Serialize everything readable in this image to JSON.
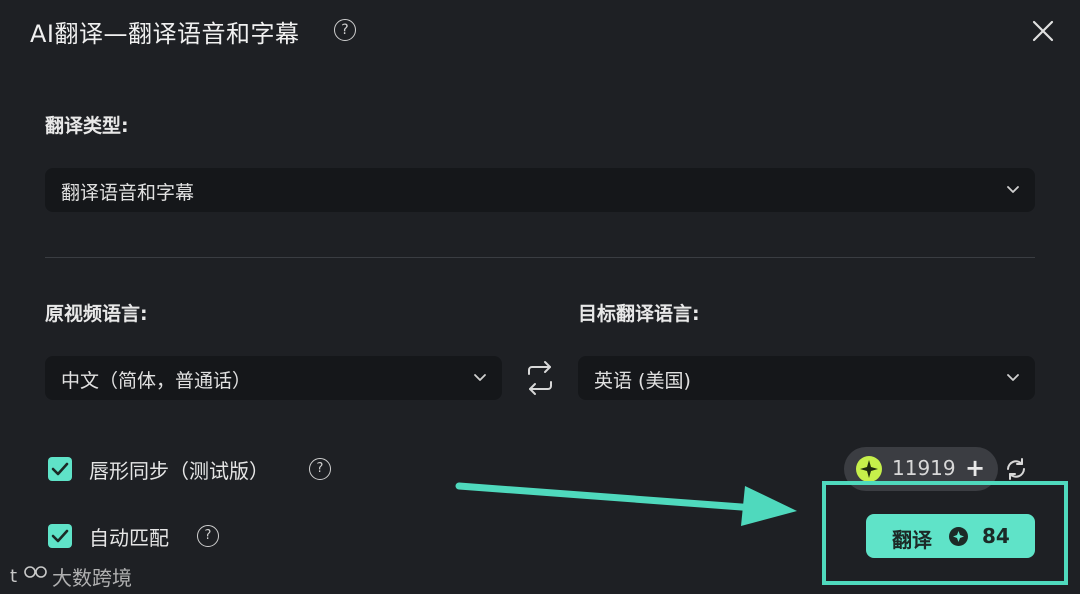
{
  "dialog": {
    "title": "AI翻译—翻译语音和字幕",
    "help_glyph": "?",
    "close_icon": "close-icon"
  },
  "translation_type": {
    "label": "翻译类型:",
    "value": "翻译语音和字幕"
  },
  "source_language": {
    "label": "原视频语言:",
    "value": "中文（简体，普通话）"
  },
  "target_language": {
    "label": "目标翻译语言:",
    "value": "英语 (美国)"
  },
  "options": {
    "lip_sync": {
      "label": "唇形同步（测试版）",
      "checked": true
    },
    "auto_match": {
      "label": "自动匹配",
      "checked": true
    }
  },
  "credits": {
    "balance": "11919",
    "plus": "+"
  },
  "translate_button": {
    "label": "翻译",
    "cost": "84"
  },
  "watermark": {
    "text": "大数跨境"
  },
  "colors": {
    "accent": "#5fe3c8",
    "background": "#1e2024",
    "field": "#15171a",
    "gem": "#c6f04b"
  }
}
